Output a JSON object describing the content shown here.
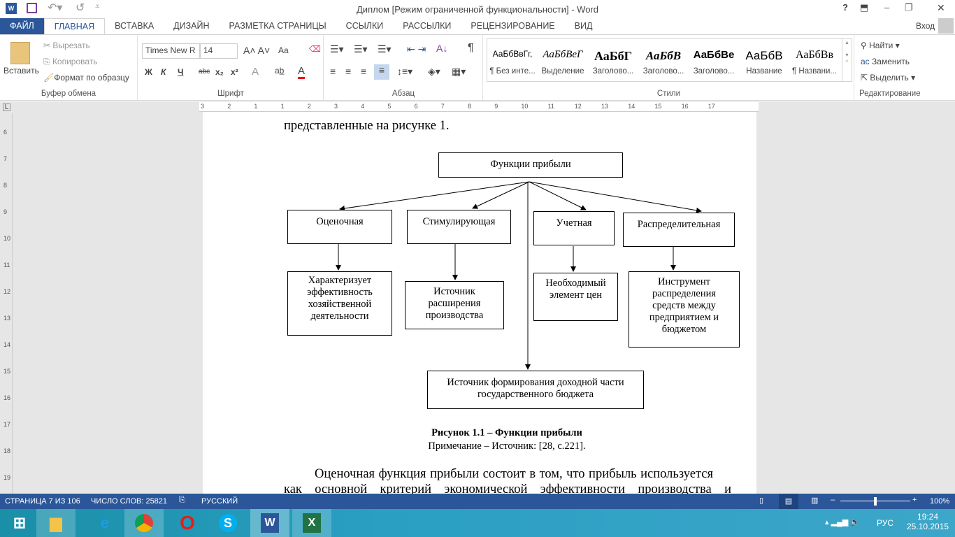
{
  "window": {
    "title": "Диплом [Режим ограниченной функциональности] - Word",
    "help": "?",
    "minimize": "–",
    "restore": "❐",
    "close": "✕",
    "signin": "Вход"
  },
  "tabs": [
    "ФАЙЛ",
    "ГЛАВНАЯ",
    "ВСТАВКА",
    "ДИЗАЙН",
    "РАЗМЕТКА СТРАНИЦЫ",
    "ССЫЛКИ",
    "РАССЫЛКИ",
    "РЕЦЕНЗИРОВАНИЕ",
    "ВИД"
  ],
  "clipboard": {
    "paste": "Вставить",
    "cut": "Вырезать",
    "copy": "Копировать",
    "format_painter": "Формат по образцу",
    "label": "Буфер обмена"
  },
  "font": {
    "name": "Times New R",
    "size": "14",
    "label": "Шрифт",
    "bold": "Ж",
    "italic": "К",
    "underline": "Ч",
    "strike": "abc",
    "sub": "x₂",
    "sup": "x²",
    "case": "Aa"
  },
  "paragraph": {
    "label": "Абзац"
  },
  "styles": {
    "label": "Стили",
    "items": [
      {
        "sample": "АаБбВвГг,",
        "name": "¶ Без инте..."
      },
      {
        "sample": "АаБбВеГ",
        "name": "Выделение"
      },
      {
        "sample": "АаБбГ",
        "name": "Заголово..."
      },
      {
        "sample": "АаБбВ",
        "name": "Заголово..."
      },
      {
        "sample": "АаБбВе",
        "name": "Заголово..."
      },
      {
        "sample": "АаБбВ",
        "name": "Название"
      },
      {
        "sample": "АаБбВв",
        "name": "¶ Названи..."
      }
    ]
  },
  "editing": {
    "find": "Найти",
    "replace": "Заменить",
    "select": "Выделить",
    "label": "Редактирование"
  },
  "ruler": {
    "h": [
      "3",
      "2",
      "1",
      "1",
      "2",
      "3",
      "4",
      "5",
      "6",
      "7",
      "8",
      "9",
      "10",
      "11",
      "12",
      "13",
      "14",
      "15",
      "16",
      "17"
    ],
    "v": [
      "6",
      "7",
      "8",
      "9",
      "10",
      "11",
      "12",
      "13",
      "14",
      "15",
      "16",
      "17",
      "18",
      "19"
    ]
  },
  "document": {
    "top_line": "представленные на рисунке 1.",
    "diagram": {
      "root": "Функции прибыли",
      "functions": [
        "Оценочная",
        "Стимулирующая",
        "Учетная",
        "Распределительная"
      ],
      "descriptions": [
        "Характеризует эффективность хозяйственной деятельности",
        "Источник расширения производства",
        "Необходимый элемент цен",
        "Инструмент распределения средств между предприятием и бюджетом"
      ],
      "bottom": "Источник формирования доходной части государственного бюджета"
    },
    "caption": "Рисунок 1.1 – Функции прибыли",
    "note": "Примечание – Источник: [28, с.221].",
    "para1": "Оценочная функция прибыли состоит в том, что прибыль используется",
    "para2": "как основной критерий экономической эффективности производства и"
  },
  "status": {
    "page": "СТРАНИЦА 7 ИЗ 106",
    "words": "ЧИСЛО СЛОВ: 25821",
    "lang": "РУССКИЙ",
    "zoom": "100%",
    "zoom_level": 100
  },
  "taskbar": {
    "lang": "РУС",
    "time": "19:24",
    "date": "25.10.2015"
  },
  "colors": {
    "accent": "#2b579a"
  }
}
